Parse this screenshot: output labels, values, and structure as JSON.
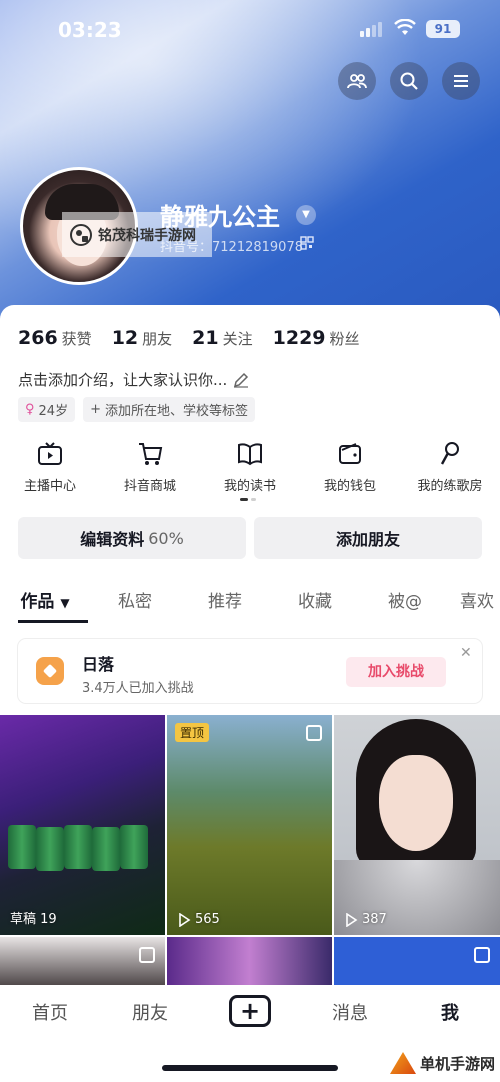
{
  "status_bar": {
    "time": "03:23",
    "battery": "91"
  },
  "profile": {
    "username": "静雅九公主",
    "douyin_id": "抖音号：71212819078",
    "watermark": "铭茂科瑞手游网"
  },
  "stats": [
    {
      "value": "266",
      "label": "获赞"
    },
    {
      "value": "12",
      "label": "朋友"
    },
    {
      "value": "21",
      "label": "关注"
    },
    {
      "value": "1229",
      "label": "粉丝"
    }
  ],
  "bio": "点击添加介绍，让大家认识你...",
  "tags": {
    "age": "24岁",
    "add_location": "添加所在地、学校等标签"
  },
  "features": [
    {
      "label": "主播中心",
      "icon": "tv-icon"
    },
    {
      "label": "抖音商城",
      "icon": "cart-icon"
    },
    {
      "label": "我的读书",
      "icon": "book-icon"
    },
    {
      "label": "我的钱包",
      "icon": "wallet-icon"
    },
    {
      "label": "我的练歌房",
      "icon": "microphone-icon"
    }
  ],
  "actions": {
    "edit_profile": "编辑资料",
    "edit_progress": "60%",
    "add_friend": "添加朋友"
  },
  "tabs": [
    "作品",
    "私密",
    "推荐",
    "收藏",
    "被@",
    "喜欢"
  ],
  "challenge": {
    "title": "日落",
    "subtitle": "3.4万人已加入挑战",
    "join_label": "加入挑战"
  },
  "videos": [
    {
      "label": "草稿 19"
    },
    {
      "badge": "置顶",
      "views": "565"
    },
    {
      "views": "387"
    }
  ],
  "nav": {
    "home": "首页",
    "friends": "朋友",
    "messages": "消息",
    "me": "我"
  },
  "corner_logo": "单机手游网"
}
